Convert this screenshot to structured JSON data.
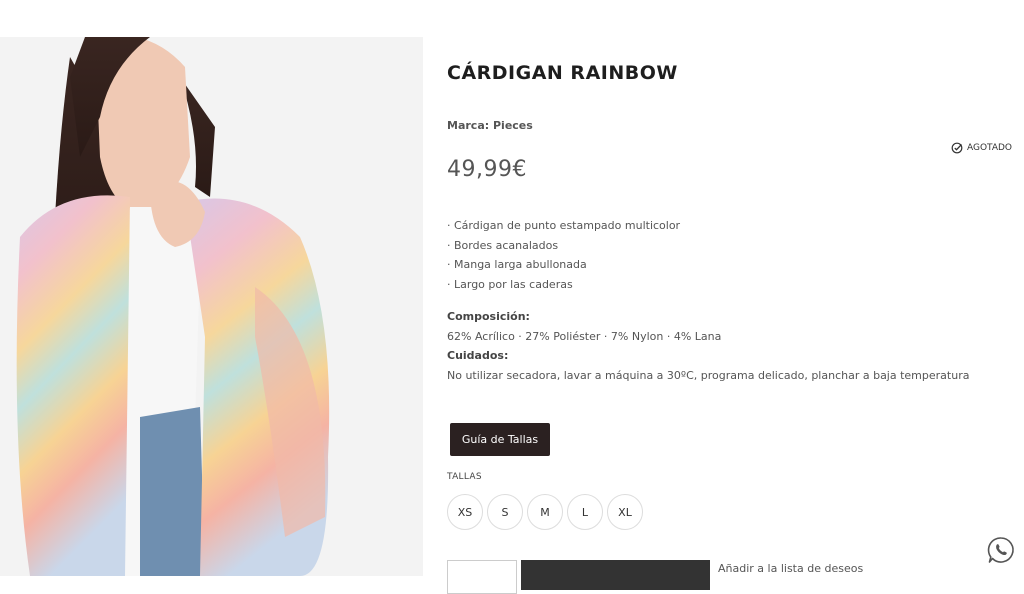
{
  "product": {
    "title": "CÁRDIGAN RAINBOW",
    "brand_label": "Marca:",
    "brand_name": "Pieces",
    "price": "49,99€",
    "stock_status": "AGOTADO",
    "features": [
      "· Cárdigan de punto estampado multicolor",
      "· Bordes acanalados",
      "· Manga larga abullonada",
      "· Largo por las caderas"
    ],
    "composition_label": "Composición:",
    "composition": "62% Acrílico · 27% Poliéster · 7% Nylon · 4% Lana",
    "care_label": "Cuidados:",
    "care": "No utilizar secadora, lavar a máquina a 30ºC, programa delicado, planchar a baja temperatura"
  },
  "size_guide_label": "Guía de Tallas",
  "sizes_label": "TALLAS",
  "sizes": [
    "XS",
    "S",
    "M",
    "L",
    "XL"
  ],
  "wishlist_label": "Añadir a la lista de deseos",
  "icons": {
    "stock": "check-circle-icon",
    "whatsapp": "whatsapp-icon"
  },
  "colors": {
    "button_dark": "#2b2121",
    "text": "#444444"
  }
}
